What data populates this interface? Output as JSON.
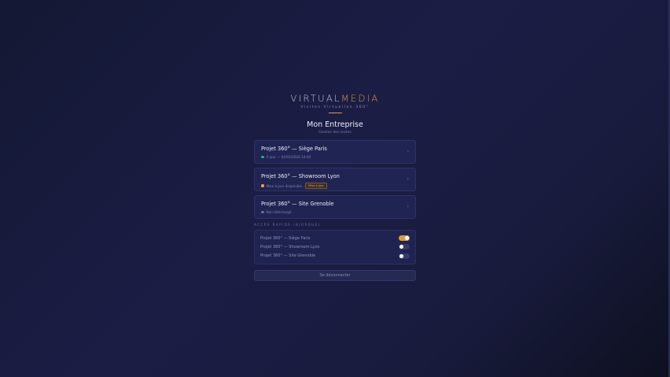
{
  "brand": {
    "logo_part1": "VIRTUAL",
    "logo_part2": "MEDIA",
    "tagline": "Visites Virtuelles 360°",
    "accent_color": "#e39a3b"
  },
  "company": {
    "name": "Mon Entreprise",
    "subtitle": "Gestion des visites"
  },
  "projects": [
    {
      "title": "Projet 360° — Siège Paris",
      "status": "À jour — 04/03/2026 14:00",
      "status_color": "#1bb589",
      "badge": "",
      "chevron_icon": "chevron-right-icon"
    },
    {
      "title": "Projet 360° — Showroom Lyon",
      "status": "Mise à jour disponible",
      "status_color": "#f0a53a",
      "badge": "Mise à jour",
      "chevron_icon": "chevron-right-icon"
    },
    {
      "title": "Projet 360° — Site Grenoble",
      "status": "Non téléchargé",
      "status_color": "#6d7196",
      "badge": "",
      "chevron_icon": "chevron-right-icon"
    }
  ],
  "quick_access": {
    "label": "ACCÈS RAPIDE (KIOSQUE)",
    "items": [
      {
        "label": "Projet 360° — Siège Paris",
        "enabled": true
      },
      {
        "label": "Projet 360° — Showroom Lyon",
        "enabled": false
      },
      {
        "label": "Projet 360° — Site Grenoble",
        "enabled": false
      }
    ]
  },
  "logout_label": "Se déconnecter",
  "chevron_glyph": "›"
}
